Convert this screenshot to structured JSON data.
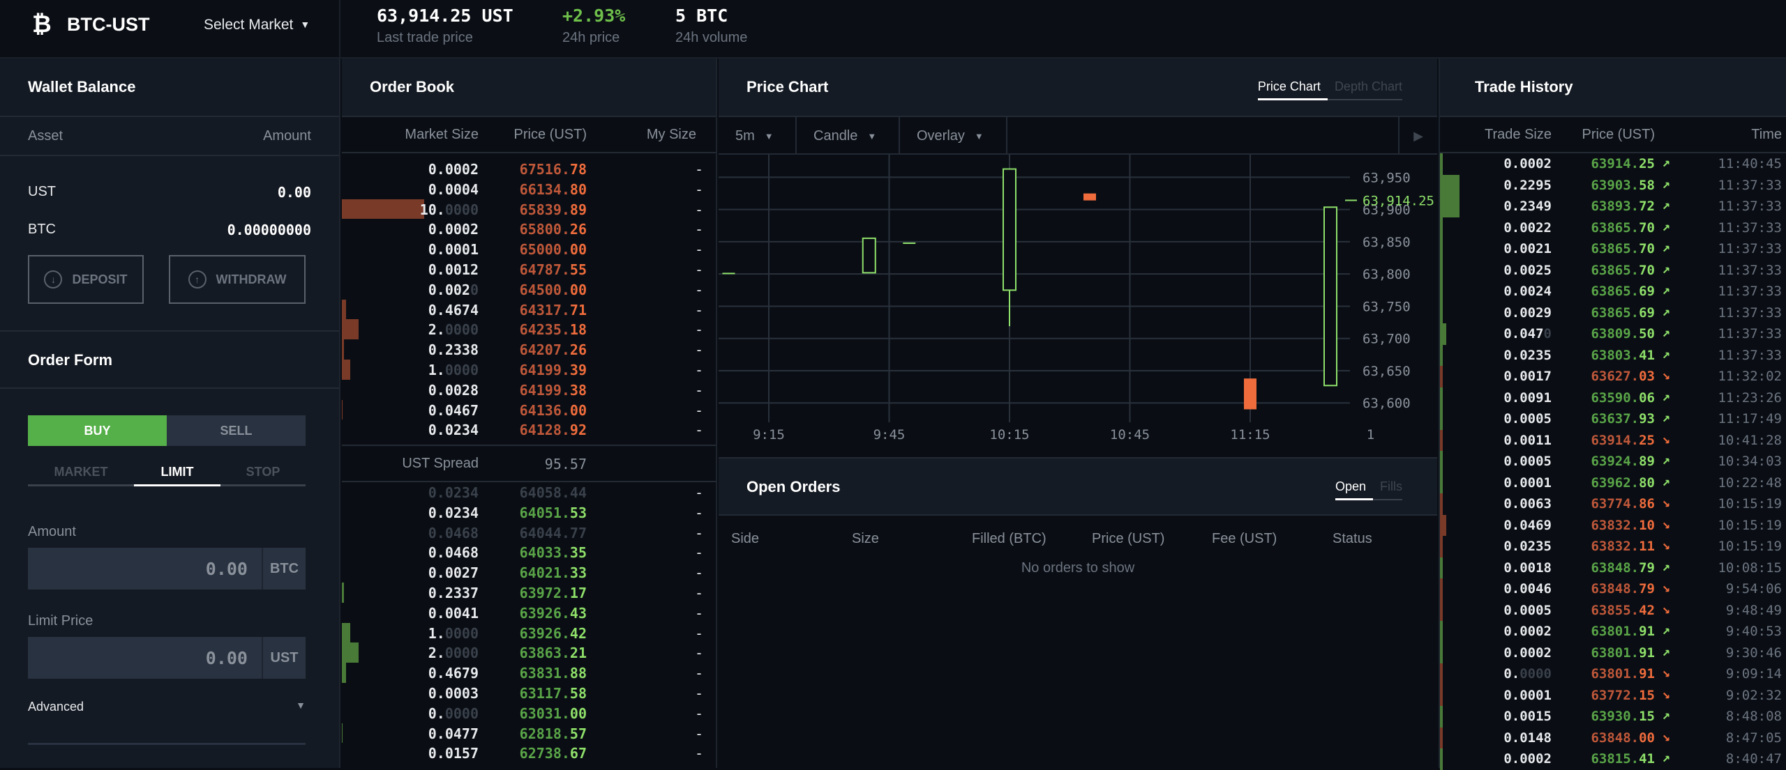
{
  "header": {
    "brand_icon": "bitcoin-icon",
    "market": "BTC-UST",
    "select_market": "Select Market",
    "last_price": "63,914.25 UST",
    "last_price_label": "Last trade price",
    "change_24h": "+2.93%",
    "change_24h_label": "24h price",
    "volume_24h": "5 BTC",
    "volume_24h_label": "24h volume"
  },
  "wallet": {
    "title": "Wallet Balance",
    "col_asset": "Asset",
    "col_amount": "Amount",
    "rows": [
      {
        "asset": "UST",
        "amount": "0.00"
      },
      {
        "asset": "BTC",
        "amount": "0.00000000"
      }
    ],
    "deposit": "DEPOSIT",
    "withdraw": "WITHDRAW"
  },
  "order_form": {
    "title": "Order Form",
    "buy": "BUY",
    "sell": "SELL",
    "side_selected": "BUY",
    "types": [
      "MARKET",
      "LIMIT",
      "STOP"
    ],
    "type_selected": "LIMIT",
    "amount_label": "Amount",
    "amount_placeholder": "0.00",
    "amount_unit": "BTC",
    "limit_label": "Limit Price",
    "limit_placeholder": "0.00",
    "limit_unit": "UST",
    "advanced": "Advanced"
  },
  "order_book": {
    "title": "Order Book",
    "col_market_size": "Market Size",
    "col_price": "Price (UST)",
    "col_my_size": "My Size",
    "spread_label": "UST Spread",
    "spread_value": "95.57",
    "asks": [
      {
        "size_main": "0.0002",
        "size_dim": "",
        "price_int": "67516.",
        "price_frac": "78",
        "my": "-",
        "depth": 0.0
      },
      {
        "size_main": "0.0004",
        "size_dim": "",
        "price_int": "66134.",
        "price_frac": "80",
        "my": "-",
        "depth": 0.0
      },
      {
        "size_main": "10.",
        "size_dim": "0000",
        "price_int": "65839.",
        "price_frac": "89",
        "my": "-",
        "depth": 1.0
      },
      {
        "size_main": "0.0002",
        "size_dim": "",
        "price_int": "65800.",
        "price_frac": "26",
        "my": "-",
        "depth": 0.0
      },
      {
        "size_main": "0.0001",
        "size_dim": "",
        "price_int": "65000.",
        "price_frac": "00",
        "my": "-",
        "depth": 0.0
      },
      {
        "size_main": "0.0012",
        "size_dim": "",
        "price_int": "64787.",
        "price_frac": "55",
        "my": "-",
        "depth": 0.0
      },
      {
        "size_main": "0.002",
        "size_dim": "0",
        "price_int": "64500.",
        "price_frac": "00",
        "my": "-",
        "depth": 0.0
      },
      {
        "size_main": "0.4674",
        "size_dim": "",
        "price_int": "64317.",
        "price_frac": "71",
        "my": "-",
        "depth": 0.047
      },
      {
        "size_main": "2.",
        "size_dim": "0000",
        "price_int": "64235.",
        "price_frac": "18",
        "my": "-",
        "depth": 0.2
      },
      {
        "size_main": "0.2338",
        "size_dim": "",
        "price_int": "64207.",
        "price_frac": "26",
        "my": "-",
        "depth": 0.023
      },
      {
        "size_main": "1.",
        "size_dim": "0000",
        "price_int": "64199.",
        "price_frac": "39",
        "my": "-",
        "depth": 0.1
      },
      {
        "size_main": "0.0028",
        "size_dim": "",
        "price_int": "64199.",
        "price_frac": "38",
        "my": "-",
        "depth": 0.0
      },
      {
        "size_main": "0.0467",
        "size_dim": "",
        "price_int": "64136.",
        "price_frac": "00",
        "my": "-",
        "depth": 0.005
      },
      {
        "size_main": "0.0234",
        "size_dim": "",
        "price_int": "64128.",
        "price_frac": "92",
        "my": "-",
        "depth": 0.0
      }
    ],
    "bids": [
      {
        "size_main": "0.0234",
        "size_dim": "",
        "price_int": "64058.",
        "price_frac": "44",
        "my": "-",
        "depth": 0.0,
        "faded": true
      },
      {
        "size_main": "0.0234",
        "size_dim": "",
        "price_int": "64051.",
        "price_frac": "53",
        "my": "-",
        "depth": 0.0
      },
      {
        "size_main": "0.0468",
        "size_dim": "",
        "price_int": "64044.",
        "price_frac": "77",
        "my": "-",
        "depth": 0.0,
        "faded": true
      },
      {
        "size_main": "0.0468",
        "size_dim": "",
        "price_int": "64033.",
        "price_frac": "35",
        "my": "-",
        "depth": 0.0
      },
      {
        "size_main": "0.0027",
        "size_dim": "",
        "price_int": "64021.",
        "price_frac": "33",
        "my": "-",
        "depth": 0.0
      },
      {
        "size_main": "0.2337",
        "size_dim": "",
        "price_int": "63972.",
        "price_frac": "17",
        "my": "-",
        "depth": 0.023
      },
      {
        "size_main": "0.0041",
        "size_dim": "",
        "price_int": "63926.",
        "price_frac": "43",
        "my": "-",
        "depth": 0.0
      },
      {
        "size_main": "1.",
        "size_dim": "0000",
        "price_int": "63926.",
        "price_frac": "42",
        "my": "-",
        "depth": 0.1
      },
      {
        "size_main": "2.",
        "size_dim": "0000",
        "price_int": "63863.",
        "price_frac": "21",
        "my": "-",
        "depth": 0.2
      },
      {
        "size_main": "0.4679",
        "size_dim": "",
        "price_int": "63831.",
        "price_frac": "88",
        "my": "-",
        "depth": 0.047
      },
      {
        "size_main": "0.0003",
        "size_dim": "",
        "price_int": "63117.",
        "price_frac": "58",
        "my": "-",
        "depth": 0.0
      },
      {
        "size_main": "0.",
        "size_dim": "0000",
        "price_int": "63031.",
        "price_frac": "00",
        "my": "-",
        "depth": 0.0
      },
      {
        "size_main": "0.0477",
        "size_dim": "",
        "price_int": "62818.",
        "price_frac": "57",
        "my": "-",
        "depth": 0.005
      },
      {
        "size_main": "0.0157",
        "size_dim": "",
        "price_int": "62738.",
        "price_frac": "67",
        "my": "-",
        "depth": 0.0
      }
    ]
  },
  "chart": {
    "title": "Price Chart",
    "tabs": [
      "Price Chart",
      "Depth Chart"
    ],
    "tab_selected": "Price Chart",
    "interval": "5m",
    "chart_type": "Candle",
    "overlay": "Overlay",
    "play_icon": "play-icon"
  },
  "chart_data": {
    "type": "candlestick",
    "title": "Price Chart",
    "x_ticks": [
      "9:15",
      "9:45",
      "10:15",
      "10:45",
      "11:15",
      "1"
    ],
    "y_ticks": [
      63600,
      63650,
      63700,
      63750,
      63800,
      63850,
      63900,
      63950
    ],
    "y_tick_labels": [
      "63,600",
      "63,650",
      "63,700",
      "63,750",
      "63,800",
      "63,850",
      "63,900",
      "63,950"
    ],
    "ylim": [
      63570,
      63985
    ],
    "last_price": 63914.25,
    "last_price_label": "63,914.25",
    "grid": true,
    "candles": [
      {
        "t": "9:05",
        "open": 63801.9,
        "close": 63801.9,
        "high": 63801.9,
        "low": 63801.9,
        "dir": "up"
      },
      {
        "t": "9:40",
        "open": 63801.9,
        "close": 63855.4,
        "high": 63855.4,
        "low": 63801.9,
        "dir": "up"
      },
      {
        "t": "9:50",
        "open": 63848.8,
        "close": 63848.8,
        "high": 63848.8,
        "low": 63848.8,
        "dir": "up"
      },
      {
        "t": "10:15",
        "open": 63774.9,
        "close": 63962.8,
        "high": 63962.8,
        "low": 63719.0,
        "dir": "up"
      },
      {
        "t": "10:35",
        "open": 63924.9,
        "close": 63914.3,
        "high": 63924.9,
        "low": 63914.3,
        "dir": "down"
      },
      {
        "t": "11:15",
        "open": 63637.9,
        "close": 63590.1,
        "high": 63637.9,
        "low": 63590.1,
        "dir": "down"
      },
      {
        "t": "11:35",
        "open": 63627.0,
        "close": 63903.6,
        "high": 63903.6,
        "low": 63627.0,
        "dir": "up"
      }
    ]
  },
  "open_orders": {
    "title": "Open Orders",
    "tabs": [
      "Open",
      "Fills"
    ],
    "tab_selected": "Open",
    "columns": [
      "Side",
      "Size",
      "Filled (BTC)",
      "Price (UST)",
      "Fee (UST)",
      "Status"
    ],
    "empty_text": "No orders to show"
  },
  "trade_history": {
    "title": "Trade History",
    "col_size": "Trade Size",
    "col_price": "Price (UST)",
    "col_time": "Time",
    "rows": [
      {
        "size_main": "0.0002",
        "size_dim": "",
        "price_int": "63914.",
        "price_frac": "25",
        "dir": "up",
        "time": "11:40:45",
        "depth": 0.0
      },
      {
        "size_main": "0.2295",
        "size_dim": "",
        "price_int": "63903.",
        "price_frac": "58",
        "dir": "up",
        "time": "11:37:33",
        "depth": 1.0
      },
      {
        "size_main": "0.2349",
        "size_dim": "",
        "price_int": "63893.",
        "price_frac": "72",
        "dir": "up",
        "time": "11:37:33",
        "depth": 1.0
      },
      {
        "size_main": "0.0022",
        "size_dim": "",
        "price_int": "63865.",
        "price_frac": "70",
        "dir": "up",
        "time": "11:37:33",
        "depth": 0.0
      },
      {
        "size_main": "0.0021",
        "size_dim": "",
        "price_int": "63865.",
        "price_frac": "70",
        "dir": "up",
        "time": "11:37:33",
        "depth": 0.0
      },
      {
        "size_main": "0.0025",
        "size_dim": "",
        "price_int": "63865.",
        "price_frac": "70",
        "dir": "up",
        "time": "11:37:33",
        "depth": 0.0
      },
      {
        "size_main": "0.0024",
        "size_dim": "",
        "price_int": "63865.",
        "price_frac": "69",
        "dir": "up",
        "time": "11:37:33",
        "depth": 0.0
      },
      {
        "size_main": "0.0029",
        "size_dim": "",
        "price_int": "63865.",
        "price_frac": "69",
        "dir": "up",
        "time": "11:37:33",
        "depth": 0.0
      },
      {
        "size_main": "0.047",
        "size_dim": "0",
        "price_int": "63809.",
        "price_frac": "50",
        "dir": "up",
        "time": "11:37:33",
        "depth": 0.2
      },
      {
        "size_main": "0.0235",
        "size_dim": "",
        "price_int": "63803.",
        "price_frac": "41",
        "dir": "up",
        "time": "11:37:33",
        "depth": 0.0
      },
      {
        "size_main": "0.0017",
        "size_dim": "",
        "price_int": "63627.",
        "price_frac": "03",
        "dir": "down",
        "time": "11:32:02",
        "depth": 0.0
      },
      {
        "size_main": "0.0091",
        "size_dim": "",
        "price_int": "63590.",
        "price_frac": "06",
        "dir": "up",
        "time": "11:23:26",
        "depth": 0.0
      },
      {
        "size_main": "0.0005",
        "size_dim": "",
        "price_int": "63637.",
        "price_frac": "93",
        "dir": "up",
        "time": "11:17:49",
        "depth": 0.0
      },
      {
        "size_main": "0.0011",
        "size_dim": "",
        "price_int": "63914.",
        "price_frac": "25",
        "dir": "down",
        "time": "10:41:28",
        "depth": 0.0
      },
      {
        "size_main": "0.0005",
        "size_dim": "",
        "price_int": "63924.",
        "price_frac": "89",
        "dir": "up",
        "time": "10:34:03",
        "depth": 0.0
      },
      {
        "size_main": "0.0001",
        "size_dim": "",
        "price_int": "63962.",
        "price_frac": "80",
        "dir": "up",
        "time": "10:22:48",
        "depth": 0.0
      },
      {
        "size_main": "0.0063",
        "size_dim": "",
        "price_int": "63774.",
        "price_frac": "86",
        "dir": "down",
        "time": "10:15:19",
        "depth": 0.0
      },
      {
        "size_main": "0.0469",
        "size_dim": "",
        "price_int": "63832.",
        "price_frac": "10",
        "dir": "down",
        "time": "10:15:19",
        "depth": 0.2
      },
      {
        "size_main": "0.0235",
        "size_dim": "",
        "price_int": "63832.",
        "price_frac": "11",
        "dir": "down",
        "time": "10:15:19",
        "depth": 0.0
      },
      {
        "size_main": "0.0018",
        "size_dim": "",
        "price_int": "63848.",
        "price_frac": "79",
        "dir": "up",
        "time": "10:08:15",
        "depth": 0.0
      },
      {
        "size_main": "0.0046",
        "size_dim": "",
        "price_int": "63848.",
        "price_frac": "79",
        "dir": "down",
        "time": "9:54:06",
        "depth": 0.0
      },
      {
        "size_main": "0.0005",
        "size_dim": "",
        "price_int": "63855.",
        "price_frac": "42",
        "dir": "down",
        "time": "9:48:49",
        "depth": 0.0
      },
      {
        "size_main": "0.0002",
        "size_dim": "",
        "price_int": "63801.",
        "price_frac": "91",
        "dir": "up",
        "time": "9:40:53",
        "depth": 0.0
      },
      {
        "size_main": "0.0002",
        "size_dim": "",
        "price_int": "63801.",
        "price_frac": "91",
        "dir": "up",
        "time": "9:30:46",
        "depth": 0.0
      },
      {
        "size_main": "0.",
        "size_dim": "0000",
        "price_int": "63801.",
        "price_frac": "91",
        "dir": "down",
        "time": "9:09:14",
        "depth": 0.0
      },
      {
        "size_main": "0.0001",
        "size_dim": "",
        "price_int": "63772.",
        "price_frac": "15",
        "dir": "down",
        "time": "9:02:32",
        "depth": 0.0
      },
      {
        "size_main": "0.0015",
        "size_dim": "",
        "price_int": "63930.",
        "price_frac": "15",
        "dir": "up",
        "time": "8:48:08",
        "depth": 0.0
      },
      {
        "size_main": "0.0148",
        "size_dim": "",
        "price_int": "63848.",
        "price_frac": "00",
        "dir": "down",
        "time": "8:47:05",
        "depth": 0.0
      },
      {
        "size_main": "0.0002",
        "size_dim": "",
        "price_int": "63815.",
        "price_frac": "41",
        "dir": "up",
        "time": "8:40:47",
        "depth": 0.0
      }
    ]
  },
  "colors": {
    "green": "#56b04a",
    "green_text": "#8fe06a",
    "red": "#f06c3c",
    "ask_bar": "#7a3a28",
    "bid_bar": "#4a7a38",
    "bg": "#0a0e14",
    "panel": "#151b24"
  }
}
